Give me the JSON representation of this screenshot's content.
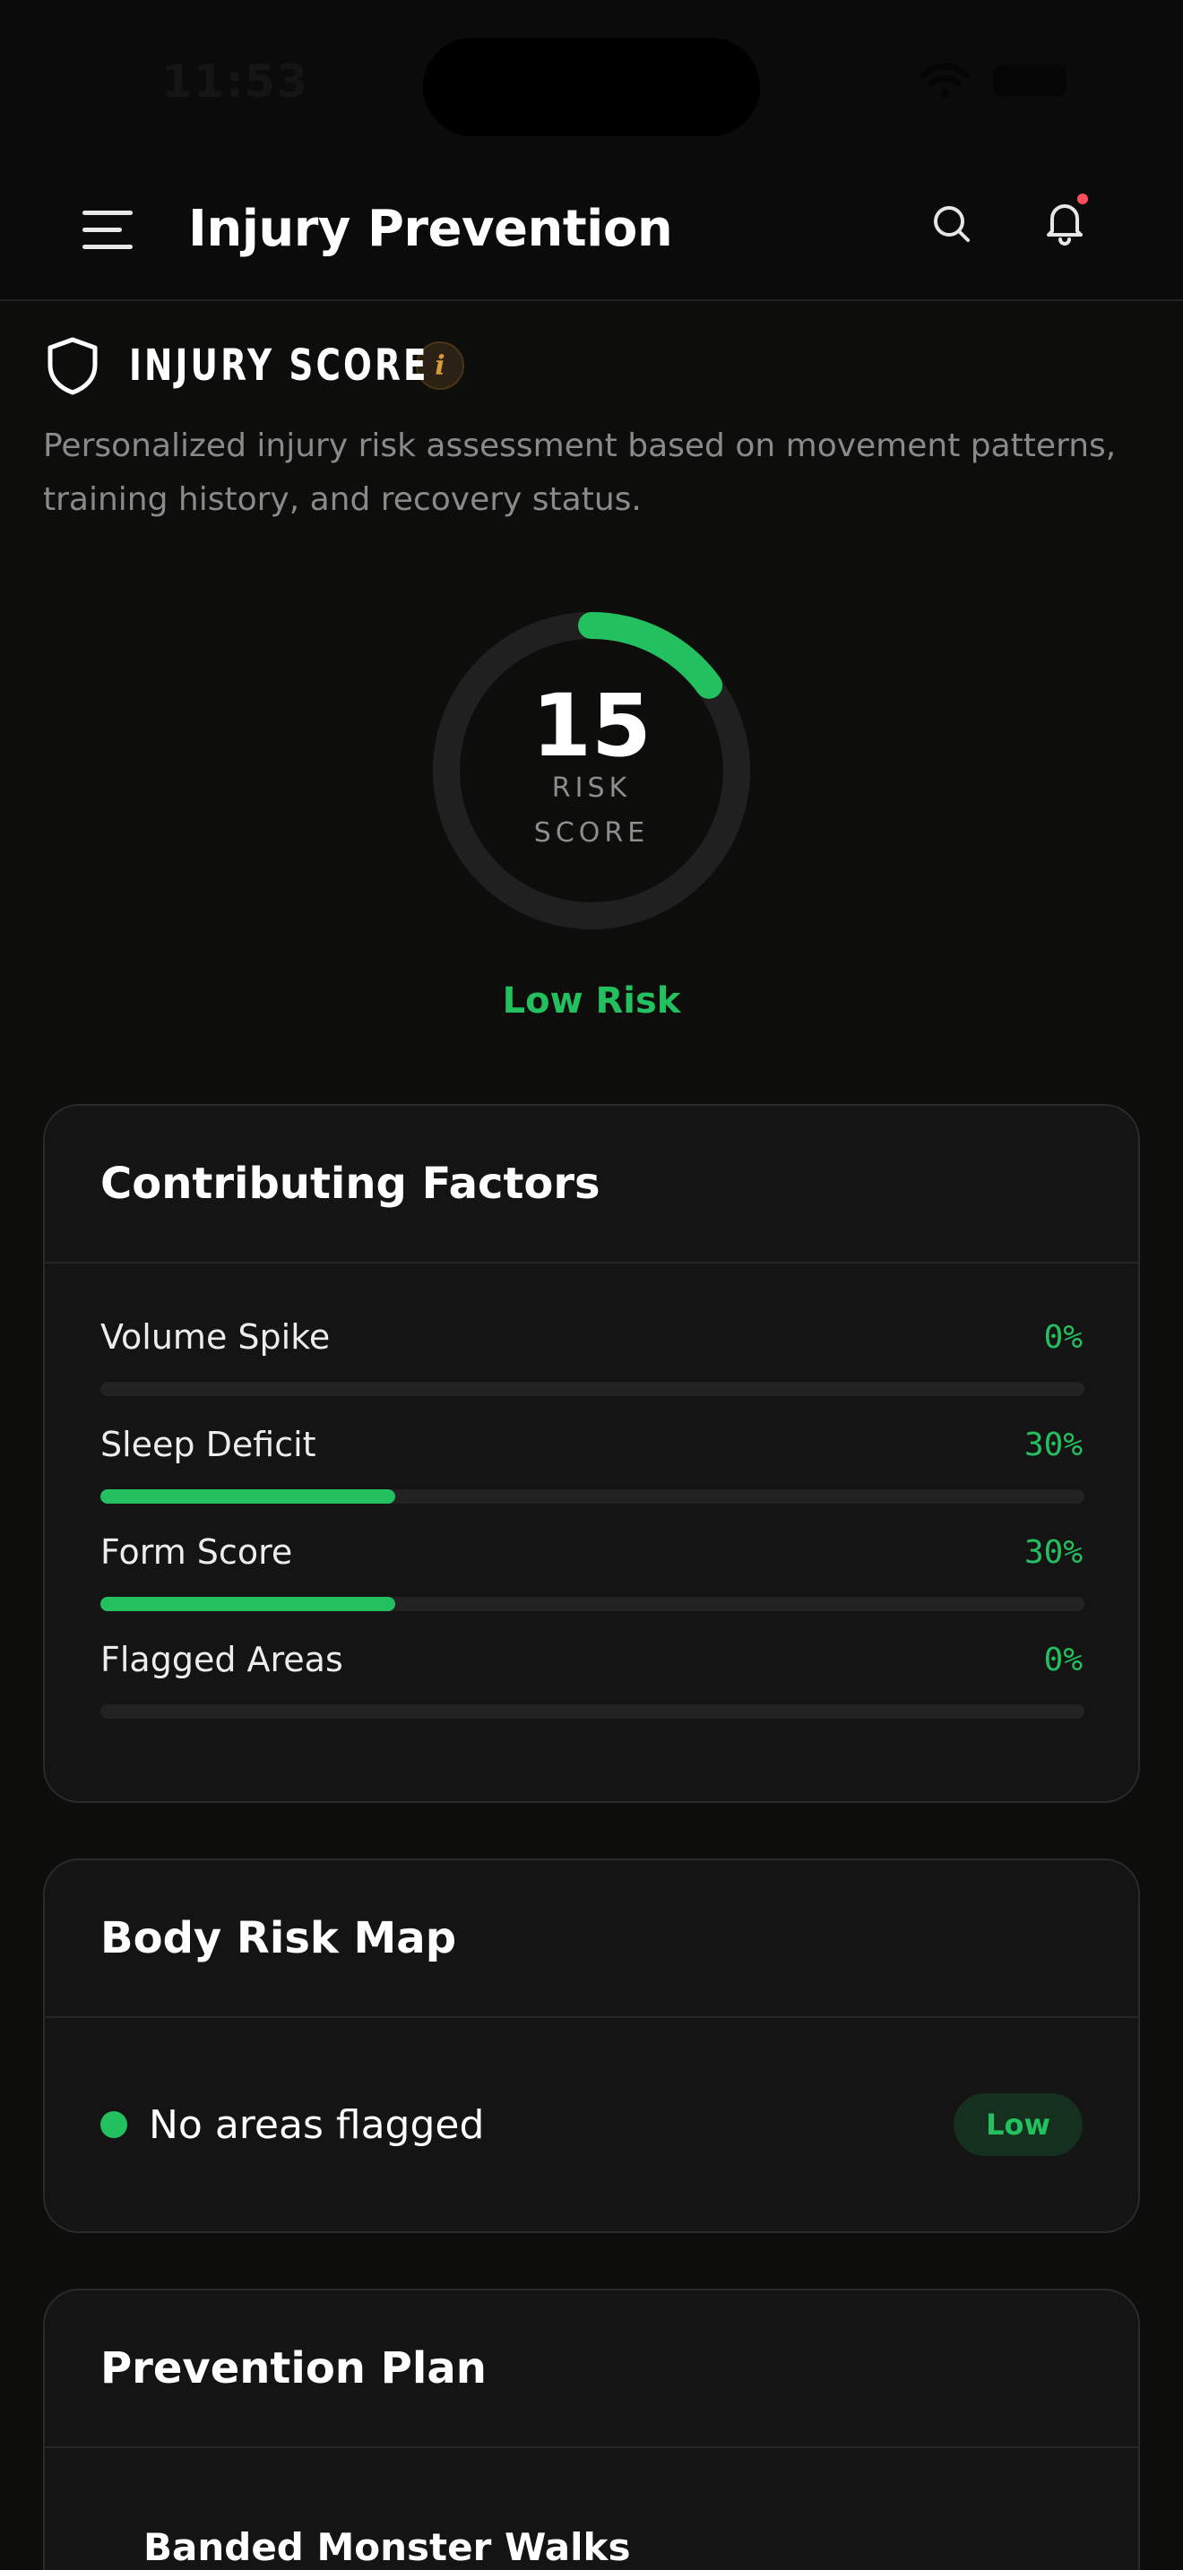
{
  "status_bar": {
    "time": "11:53"
  },
  "header": {
    "title": "Injury Prevention"
  },
  "injury_score": {
    "title": "INJURY SCORE",
    "info": "i",
    "description": "Personalized injury risk assessment based on movement patterns, training history, and recovery status.",
    "score": "15",
    "score_fraction": 0.15,
    "label_line1": "RISK",
    "label_line2": "SCORE",
    "risk_level": "Low Risk"
  },
  "factors": {
    "title": "Contributing Factors",
    "items": [
      {
        "label": "Volume Spike",
        "value": "0%",
        "fraction": 0
      },
      {
        "label": "Sleep Deficit",
        "value": "30%",
        "fraction": 0.3
      },
      {
        "label": "Form Score",
        "value": "30%",
        "fraction": 0.3
      },
      {
        "label": "Flagged Areas",
        "value": "0%",
        "fraction": 0
      }
    ]
  },
  "body_map": {
    "title": "Body Risk Map",
    "status": "No areas flagged",
    "badge": "Low"
  },
  "plan": {
    "title": "Prevention Plan",
    "first_item": "Banded Monster Walks"
  },
  "colors": {
    "accent": "#22c05e",
    "background": "#0d0d0c",
    "card": "#141414",
    "info": "#d69a3c"
  }
}
